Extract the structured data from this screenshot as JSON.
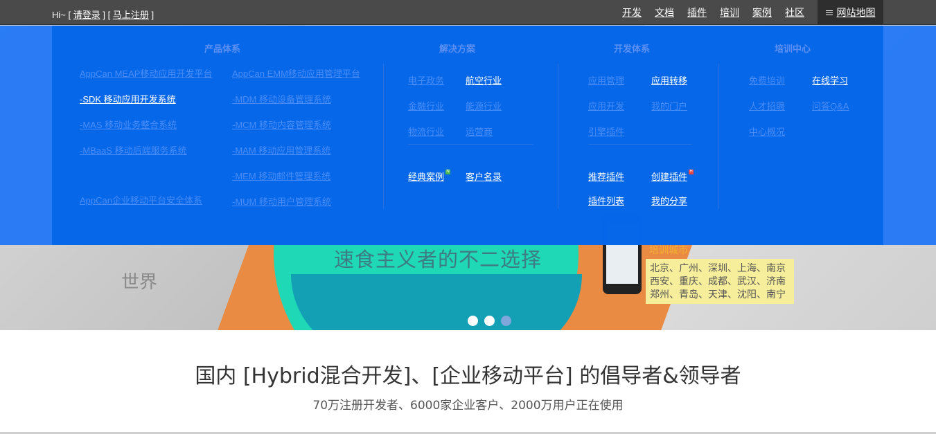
{
  "topbar": {
    "greeting_prefix": "Hi~ [",
    "login": "请登录",
    "mid": "] [",
    "register": "马上注册",
    "suffix": "]",
    "nav": [
      "开发",
      "文档",
      "插件",
      "培训",
      "案例",
      "社区"
    ],
    "sitemap": "网站地图"
  },
  "mega": {
    "products": {
      "title": "产品体系",
      "left": [
        "AppCan MEAP移动应用开发平台",
        "-SDK 移动应用开发系统",
        "-MAS 移动业务整合系统",
        "-MBaaS 移动后端服务系统",
        "AppCan企业移动平台安全体系"
      ],
      "right": [
        "AppCan EMM移动应用管理平台",
        "-MDM 移动设备管理系统",
        "-MCM 移动内容管理系统",
        "-MAM 移动应用管理系统",
        "-MEM 移动邮件管理系统",
        "-MUM 移动用户管理系统"
      ]
    },
    "solutions": {
      "title": "解决方案",
      "items": [
        "电子政务",
        "航空行业",
        "金融行业",
        "能源行业",
        "物流行业",
        "运营商"
      ],
      "cases": "经典案例",
      "cases_badge": "N",
      "clients": "客户名录"
    },
    "dev": {
      "title": "开发体系",
      "items": [
        "应用管理",
        "应用转移",
        "应用开发",
        "我的门户",
        "引擎插件"
      ],
      "recommended": "推荐插件",
      "create": "创建插件",
      "create_badge": "H",
      "list": "插件列表",
      "share": "我的分享"
    },
    "training": {
      "title": "培训中心",
      "items": [
        "免费培训",
        "在线学习",
        "人才招聘",
        "问答Q&A",
        "中心概况"
      ]
    }
  },
  "hero": {
    "slogan": "速食主义者的不二选择",
    "cities_title": "培训城市",
    "cities": [
      "北京、广州、深圳、上海、南京",
      "西安、重庆、成都、武汉、济南",
      "郑州、青岛、天津、沈阳、南宁"
    ],
    "watermark": "世界"
  },
  "headline": "国内 [Hybrid混合开发]、[企业移动平台] 的倡导者&领导者",
  "subline": "70万注册开发者、6000家企业客户、2000万用户正在使用"
}
